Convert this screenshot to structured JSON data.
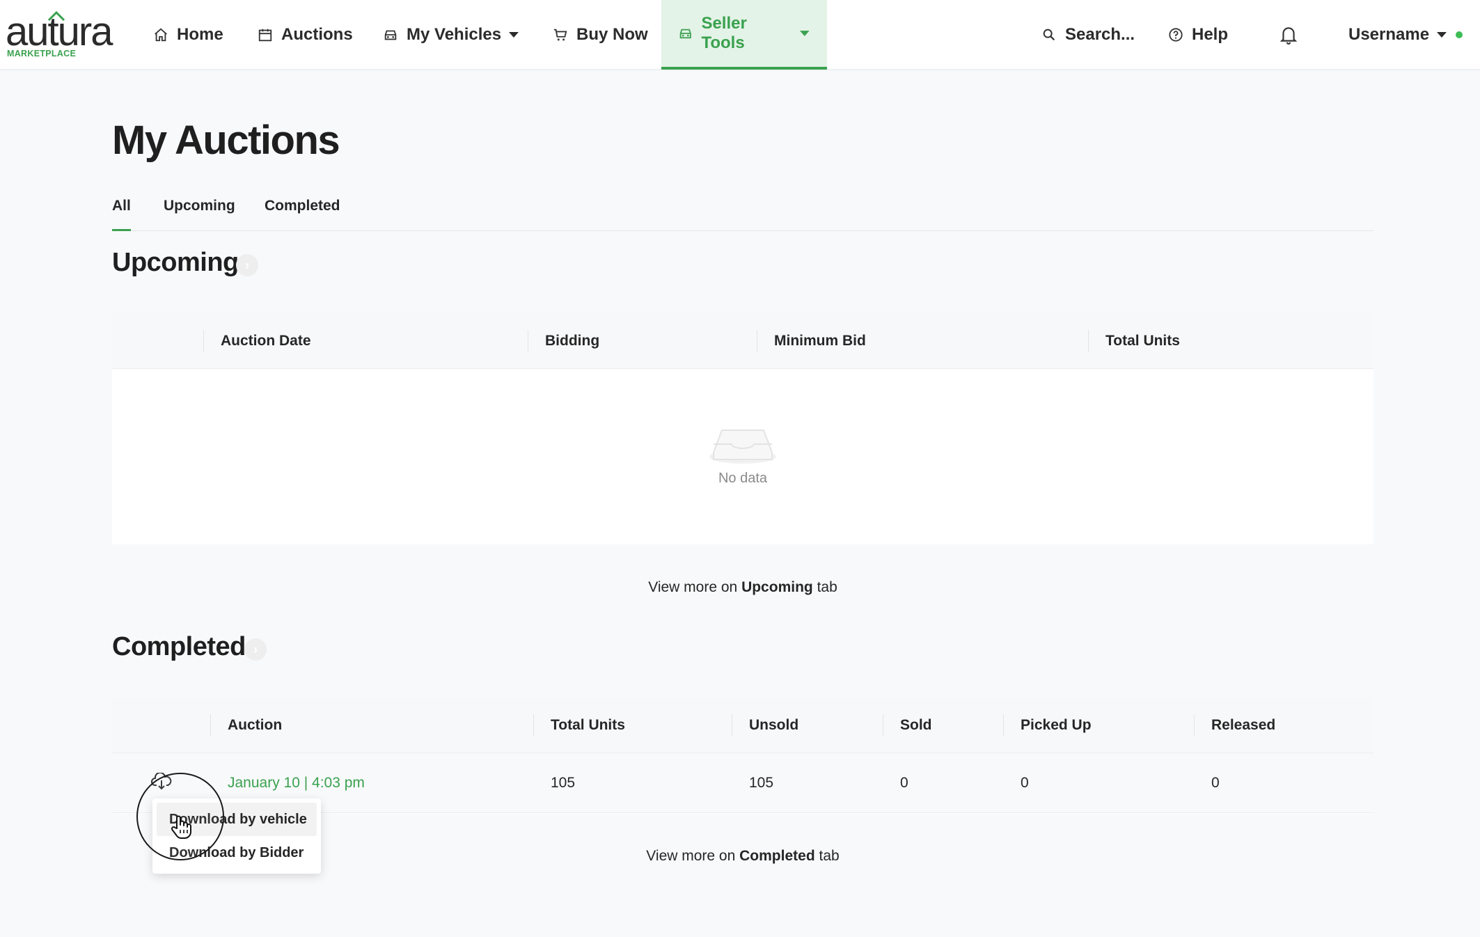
{
  "brand": {
    "logo_word": "autura",
    "logo_sub": "MARKETPLACE",
    "accent_color": "#3aa14f"
  },
  "nav": {
    "home": "Home",
    "auctions": "Auctions",
    "my_vehicles": "My Vehicles",
    "buy_now": "Buy Now",
    "seller_tools": "Seller Tools",
    "search": "Search...",
    "help": "Help",
    "username": "Username",
    "icons": [
      "home-icon",
      "calendar-icon",
      "car-icon",
      "cart-icon",
      "car-icon",
      "search-icon",
      "help-icon",
      "bell-icon",
      "caret-down-icon"
    ]
  },
  "page": {
    "title": "My Auctions",
    "tabs": [
      "All",
      "Upcoming",
      "Completed"
    ],
    "active_tab": "All"
  },
  "upcoming": {
    "title": "Upcoming",
    "columns": [
      "Auction Date",
      "Bidding",
      "Minimum Bid",
      "Total Units"
    ],
    "empty_text": "No data",
    "view_more_prefix": "View more on",
    "view_more_tab": "Upcoming",
    "view_more_suffix": "tab"
  },
  "completed": {
    "title": "Completed",
    "columns": [
      "Auction",
      "Total Units",
      "Unsold",
      "Sold",
      "Picked Up",
      "Released"
    ],
    "rows": [
      {
        "auction": "January 10 | 4:03 pm",
        "total_units": "105",
        "unsold": "105",
        "sold": "0",
        "picked_up": "0",
        "released": "0"
      }
    ],
    "view_more_prefix": "View more on",
    "view_more_tab": "Completed",
    "view_more_suffix": "tab"
  },
  "download_menu": {
    "items": [
      "Download by vehicle",
      "Download by Bidder"
    ],
    "hovered": "Download by vehicle"
  }
}
